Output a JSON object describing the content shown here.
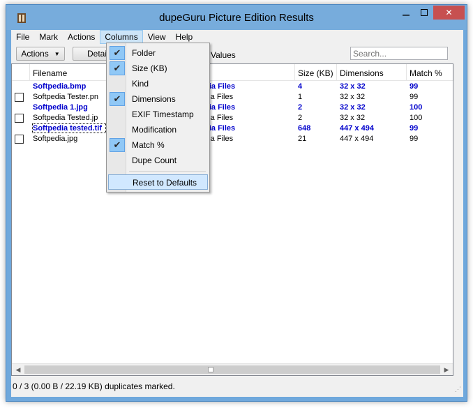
{
  "window": {
    "title": "dupeGuru Picture Edition Results",
    "controls": {
      "close": "✕"
    }
  },
  "menu": [
    "File",
    "Mark",
    "Actions",
    "Columns",
    "View",
    "Help"
  ],
  "toolbar": {
    "actions_label": "Actions",
    "details_label": "Details",
    "delta_label": "lta Values",
    "search_placeholder": "Search..."
  },
  "table": {
    "headers": {
      "filename": "Filename",
      "size": "Size (KB)",
      "dimensions": "Dimensions",
      "match": "Match %"
    },
    "rows": [
      {
        "filename": "Softpedia.bmp",
        "folder": "edia Files",
        "size": "4",
        "dimensions": "32 x 32",
        "match": "99",
        "ref": true
      },
      {
        "filename": "Softpedia Tester.pn",
        "folder": "edia Files",
        "size": "1",
        "dimensions": "32 x 32",
        "match": "99",
        "ref": false
      },
      {
        "filename": "Softpedia 1.jpg",
        "folder": "edia Files",
        "size": "2",
        "dimensions": "32 x 32",
        "match": "100",
        "ref": true
      },
      {
        "filename": "Softpedia Tested.jp",
        "folder": "edia Files",
        "size": "2",
        "dimensions": "32 x 32",
        "match": "100",
        "ref": false
      },
      {
        "filename": "Softpedia tested.tif",
        "folder": "edia Files",
        "size": "648",
        "dimensions": "447 x 494",
        "match": "99",
        "ref": true
      },
      {
        "filename": "Softpedia.jpg",
        "folder": "edia Files",
        "size": "21",
        "dimensions": "447 x 494",
        "match": "99",
        "ref": false
      }
    ]
  },
  "columns_menu": {
    "items": [
      {
        "label": "Folder",
        "checked": true
      },
      {
        "label": "Size (KB)",
        "checked": true
      },
      {
        "label": "Kind",
        "checked": false
      },
      {
        "label": "Dimensions",
        "checked": true
      },
      {
        "label": "EXIF Timestamp",
        "checked": false
      },
      {
        "label": "Modification",
        "checked": false
      },
      {
        "label": "Match %",
        "checked": true
      },
      {
        "label": "Dupe Count",
        "checked": false
      }
    ],
    "reset_label": "Reset to Defaults"
  },
  "status": "0 / 3 (0.00 B / 22.19 KB) duplicates marked."
}
